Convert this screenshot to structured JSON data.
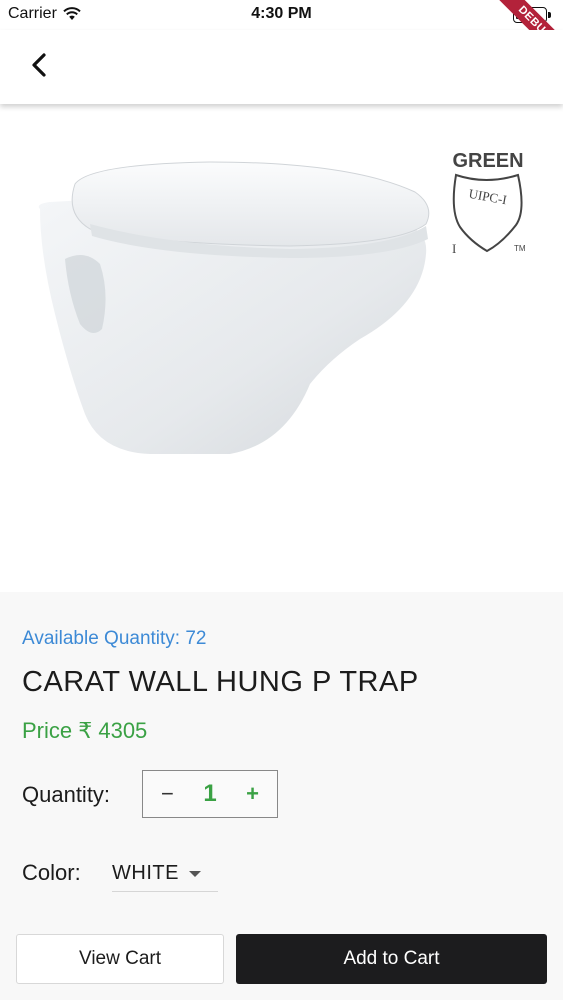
{
  "status_bar": {
    "carrier": "Carrier",
    "time": "4:30 PM",
    "wifi_icon": "wifi-icon",
    "battery_icon": "battery-icon"
  },
  "debug_banner": "DEBUG",
  "app_bar": {
    "back_icon": "chevron-left-icon"
  },
  "certification": {
    "top_text": "GREEN",
    "shield_text": "UIPC-I",
    "left_mark": "I",
    "trademark": "TM"
  },
  "product": {
    "available_quantity": "Available Quantity: 72",
    "name": "CARAT WALL HUNG P TRAP",
    "price": "Price ₹ 4305"
  },
  "quantity": {
    "label": "Quantity:",
    "minus": "−",
    "value": "1",
    "plus": "+"
  },
  "color": {
    "label": "Color:",
    "selected": "WHITE"
  },
  "actions": {
    "view_cart": "View Cart",
    "add_to_cart": "Add to Cart"
  },
  "colors": {
    "accent_green": "#3aa144",
    "info_blue": "#3d8ad6",
    "primary_button": "#1c1c1e",
    "debug_ribbon": "#b3223a"
  }
}
